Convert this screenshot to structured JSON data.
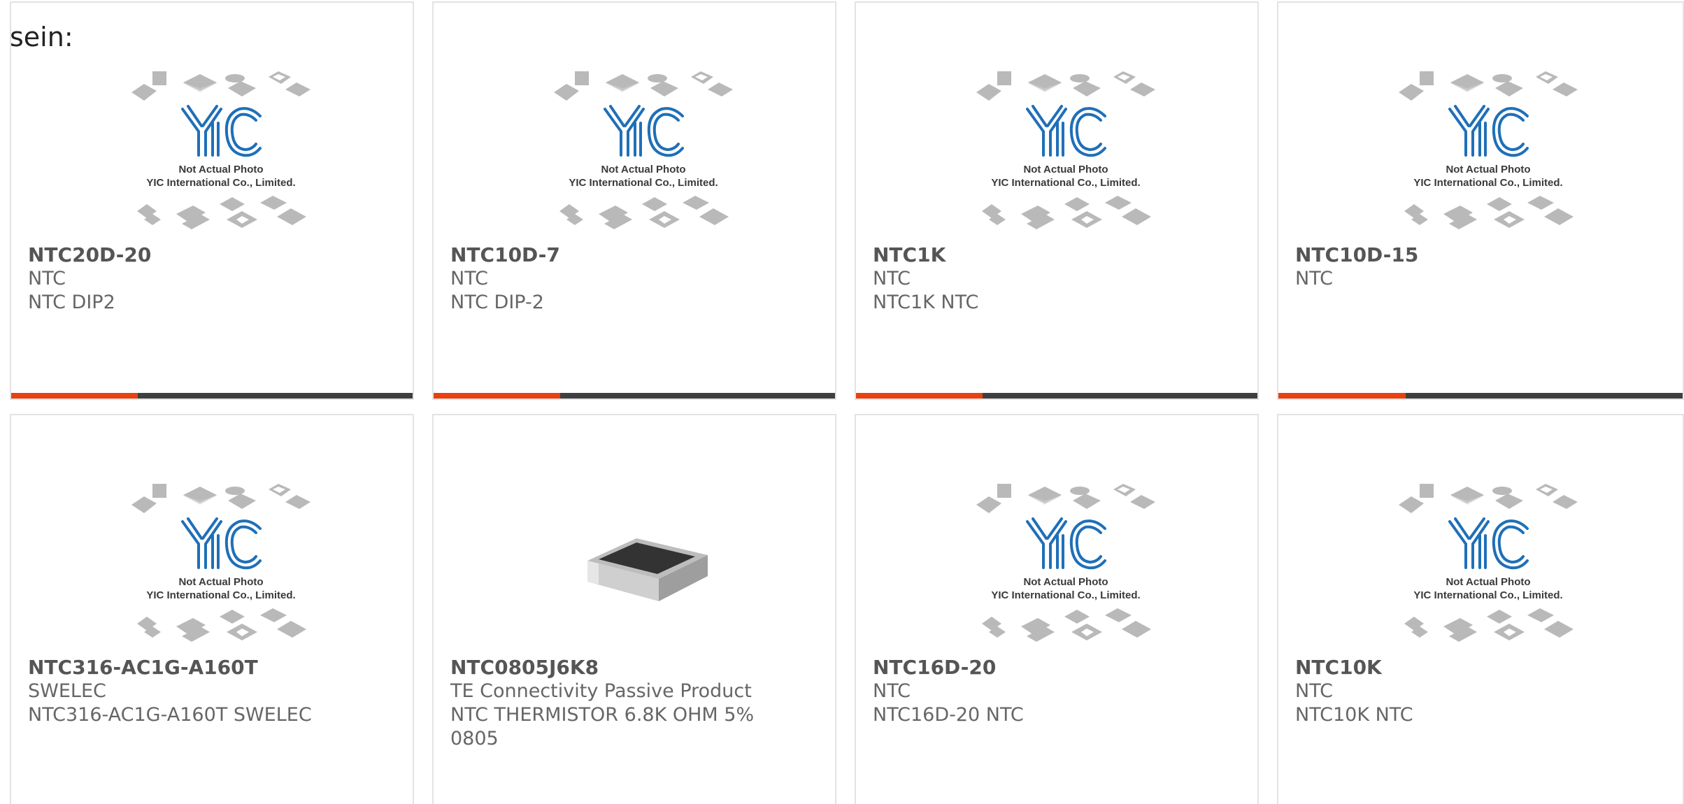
{
  "intro_text": "sein:",
  "placeholder": {
    "logo_text": "YIC",
    "line1": "Not Actual Photo",
    "line2": "YIC International Co., Limited."
  },
  "products": [
    {
      "part": "NTC20D-20",
      "maker": "NTC",
      "desc": "NTC DIP2",
      "image": "placeholder"
    },
    {
      "part": "NTC10D-7",
      "maker": "NTC",
      "desc": "NTC DIP-2",
      "image": "placeholder"
    },
    {
      "part": "NTC1K",
      "maker": "NTC",
      "desc": "NTC1K NTC",
      "image": "placeholder"
    },
    {
      "part": "NTC10D-15",
      "maker": "NTC",
      "desc": "",
      "image": "placeholder"
    },
    {
      "part": "NTC316-AC1G-A160T",
      "maker": "SWELEC",
      "desc": "NTC316-AC1G-A160T SWELEC",
      "image": "placeholder"
    },
    {
      "part": "NTC0805J6K8",
      "maker": "TE Connectivity Passive Product",
      "desc": "NTC THERMISTOR 6.8K OHM 5% 0805",
      "image": "chip-resistor"
    },
    {
      "part": "NTC16D-20",
      "maker": "NTC",
      "desc": "NTC16D-20 NTC",
      "image": "placeholder"
    },
    {
      "part": "NTC10K",
      "maker": "NTC",
      "desc": "NTC10K NTC",
      "image": "placeholder"
    }
  ],
  "colors": {
    "accent": "#e8410f",
    "bar_dark": "#3f3f3f",
    "logo_blue": "#1f6fb8"
  }
}
